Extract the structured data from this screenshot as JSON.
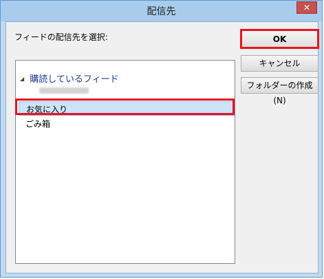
{
  "window": {
    "title": "配信先",
    "close_label": "✕"
  },
  "prompt_label": "フィードの配信先を選択:",
  "tree": {
    "root_label": "購読しているフィード",
    "items": [
      "お気に入り",
      "ごみ箱"
    ]
  },
  "buttons": {
    "ok": "OK",
    "cancel": "キャンセル",
    "new_folder": "フォルダーの作成(N)"
  }
}
